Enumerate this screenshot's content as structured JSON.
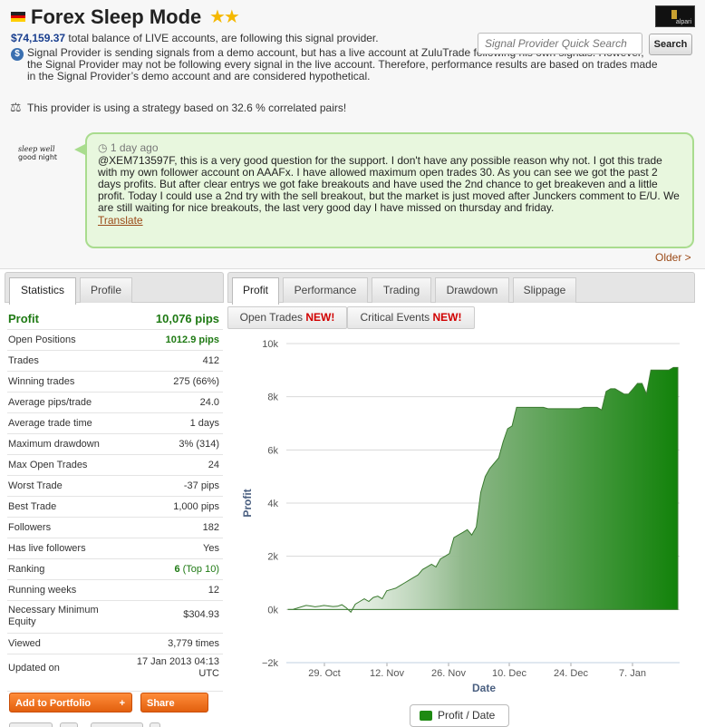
{
  "header": {
    "title": "Forex Sleep Mode",
    "stars": "★★",
    "avatar_label": "alpari",
    "balance_amount": "$74,159.37",
    "balance_text": " total balance of LIVE accounts, are following this signal provider.",
    "demo_notice": "Signal Provider is sending signals from a demo account, but has a live account at ZuluTrade following his own signals. However, the Signal Provider may not be following every signal in the live account. Therefore, performance results are based on trades made in the Signal Provider’s demo account and are considered hypothetical.",
    "correlation_notice": "This provider is using a strategy based on 32.6 % correlated pairs!"
  },
  "search": {
    "placeholder": "Signal Provider Quick Search",
    "button_label": "Search"
  },
  "comment": {
    "author_line1": "sleep well",
    "author_line2": "good night",
    "time": "1 day ago",
    "text": "@XEM713597F, this is a very good question for the support. I don't have any possible reason why not. I got this trade with my own follower account on AAAFx. I have allowed maximum open trades 30. As you can see we got the past 2 days profits. But after clear entrys we got fake breakouts and have used the 2nd chance to get breakeven and a little profit. Today I could use a 2nd try with the sell breakout, but the market is just moved after Junckers comment to E/U. We are still waiting for nice breakouts, the last very good day I have missed on thursday and friday.",
    "translate": "Translate",
    "older": "Older >"
  },
  "left_tabs": [
    "Statistics",
    "Profile"
  ],
  "stats": [
    {
      "label": "Profit",
      "value": "10,076 pips"
    },
    {
      "label": "Open Positions",
      "value": "1012.9 pips"
    },
    {
      "label": "Trades",
      "value": "412"
    },
    {
      "label": "Winning trades",
      "value": "275 (66%)"
    },
    {
      "label": "Average pips/trade",
      "value": "24.0"
    },
    {
      "label": "Average trade time",
      "value": "1 days"
    },
    {
      "label": "Maximum drawdown",
      "value": "3% (314)"
    },
    {
      "label": "Max Open Trades",
      "value": "24"
    },
    {
      "label": "Worst Trade",
      "value": "-37 pips"
    },
    {
      "label": "Best Trade",
      "value": "1,000 pips"
    },
    {
      "label": "Followers",
      "value": "182"
    },
    {
      "label": "Has live followers",
      "value": "Yes"
    },
    {
      "label": "Ranking",
      "value": "6",
      "value_extra": " (Top 10)"
    },
    {
      "label": "Running weeks",
      "value": "12"
    },
    {
      "label": "Necessary Minimum Equity",
      "value": "$304.93"
    },
    {
      "label": "Viewed",
      "value": "3,779 times"
    },
    {
      "label": "Updated on",
      "value": "17 Jan 2013 04:13 UTC"
    }
  ],
  "buttons": {
    "add_portfolio": "Add to Portfolio",
    "add_portfolio_plus": "+",
    "share": "Share"
  },
  "right_tabs": [
    "Profit",
    "Performance",
    "Trading",
    "Drawdown",
    "Slippage"
  ],
  "subtabs": [
    {
      "label": "Open Trades ",
      "badge": "NEW!"
    },
    {
      "label": "Critical Events ",
      "badge": "NEW!"
    }
  ],
  "colors": {
    "accent_green": "#1f7a14",
    "area_green": "#1e8a12",
    "link_brown": "#9b4a18",
    "orange": "#f07a22"
  },
  "chart_data": {
    "type": "area",
    "xlabel": "Date",
    "ylabel": "Profit",
    "ylim": [
      -2000,
      10000
    ],
    "yticks": [
      -2000,
      0,
      2000,
      4000,
      6000,
      8000,
      10000
    ],
    "ytick_labels": [
      "−2k",
      "0k",
      "2k",
      "4k",
      "6k",
      "8k",
      "10k"
    ],
    "xticks": [
      "29. Oct",
      "12. Nov",
      "26. Nov",
      "10. Dec",
      "24. Dec",
      "7. Jan"
    ],
    "grid": true,
    "legend": "bottom-center",
    "series": [
      {
        "name": "Profit / Date",
        "x": [
          0,
          1,
          2,
          3,
          4,
          5,
          6,
          7,
          8,
          9,
          10,
          11,
          12,
          13,
          14,
          15,
          16,
          17,
          18,
          19,
          20,
          21,
          22,
          23,
          24,
          25,
          26,
          27,
          28,
          29,
          30,
          31,
          32,
          33,
          34,
          35,
          36,
          37,
          38,
          39,
          40,
          41,
          42,
          43,
          44,
          45,
          46,
          47,
          48,
          49,
          50,
          51,
          52,
          53,
          54,
          55,
          56,
          57,
          58,
          59,
          60,
          61,
          62,
          63,
          64,
          65,
          66,
          67,
          68,
          69,
          70,
          71,
          72,
          73,
          74,
          75,
          76,
          77,
          78,
          79,
          80,
          81,
          82,
          83,
          84,
          85,
          86,
          87
        ],
        "values": [
          0,
          0,
          50,
          100,
          150,
          130,
          100,
          120,
          150,
          130,
          110,
          120,
          180,
          60,
          -100,
          200,
          300,
          400,
          300,
          450,
          500,
          400,
          700,
          750,
          800,
          900,
          1000,
          1100,
          1200,
          1300,
          1500,
          1600,
          1700,
          1600,
          1900,
          2000,
          2100,
          2700,
          2800,
          2900,
          3000,
          2800,
          3100,
          4400,
          5000,
          5300,
          5500,
          5700,
          6300,
          6800,
          6900,
          7600,
          7600,
          7600,
          7600,
          7600,
          7600,
          7600,
          7550,
          7550,
          7550,
          7550,
          7550,
          7550,
          7550,
          7550,
          7600,
          7600,
          7600,
          7600,
          7500,
          8200,
          8300,
          8300,
          8200,
          8100,
          8100,
          8300,
          8500,
          8500,
          8100,
          9000,
          9000,
          9000,
          9000,
          9000,
          9100,
          9100
        ]
      }
    ]
  }
}
